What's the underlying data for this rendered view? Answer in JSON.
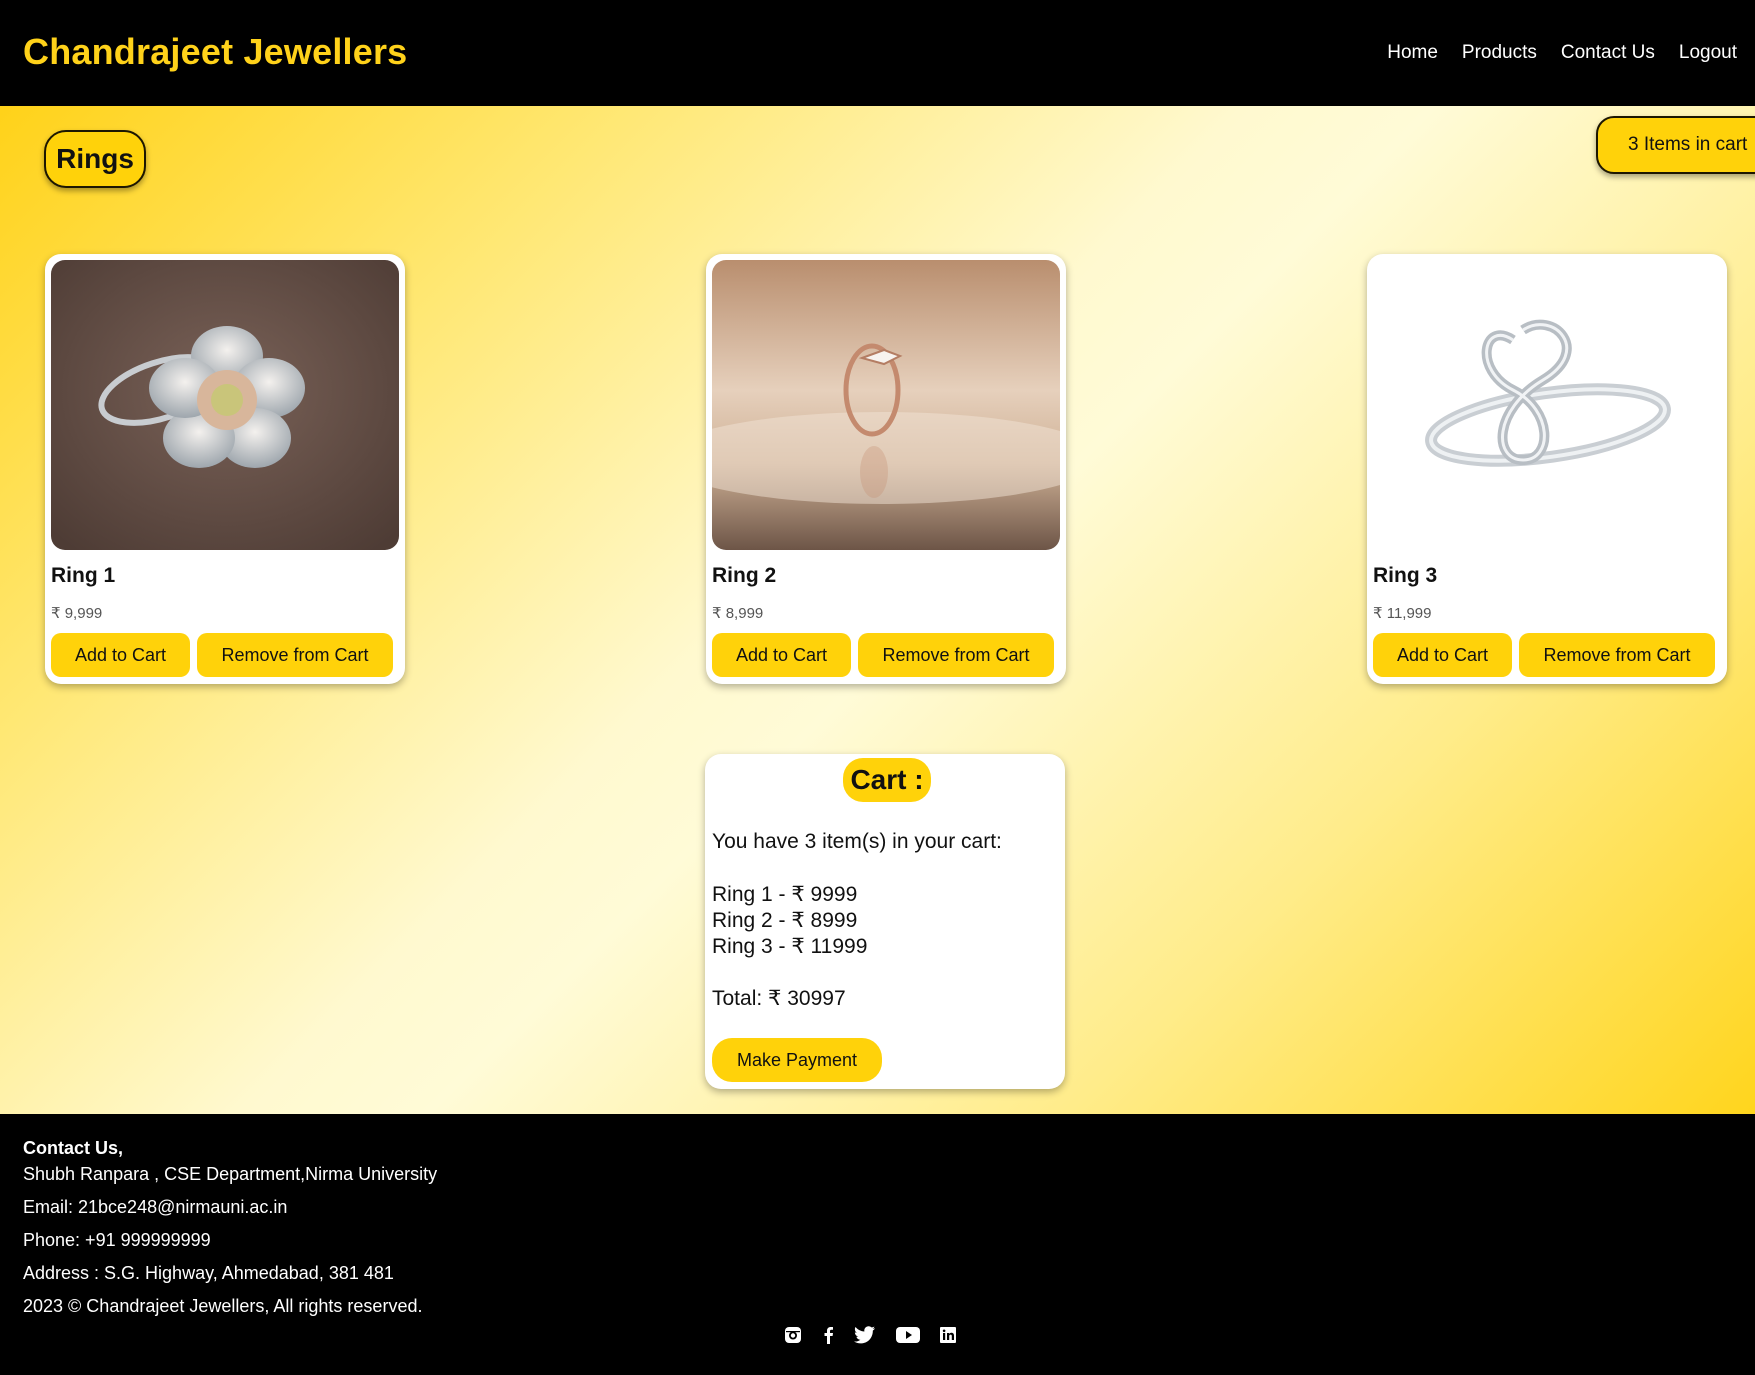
{
  "header": {
    "brand": "Chandrajeet Jewellers",
    "nav": [
      "Home",
      "Products",
      "Contact Us",
      "Logout"
    ]
  },
  "main": {
    "section_title": "Rings",
    "cart_count_label": "3 Items in cart",
    "products": [
      {
        "name": "Ring 1",
        "price": "₹ 9,999",
        "add_label": "Add to Cart",
        "remove_label": "Remove from Cart"
      },
      {
        "name": "Ring 2",
        "price": "₹ 8,999",
        "add_label": "Add to Cart",
        "remove_label": "Remove from Cart"
      },
      {
        "name": "Ring 3",
        "price": "₹ 11,999",
        "add_label": "Add to Cart",
        "remove_label": "Remove from Cart"
      }
    ],
    "cart": {
      "title": "Cart :",
      "summary": "You have 3 item(s) in your cart:",
      "items": [
        "Ring 1 - ₹ 9999",
        "Ring 2 - ₹ 8999",
        "Ring 3 - ₹ 11999"
      ],
      "total": "Total: ₹ 30997",
      "pay_label": "Make Payment"
    }
  },
  "footer": {
    "heading": "Contact Us,",
    "lines": [
      "Shubh Ranpara , CSE Department,Nirma University",
      "Email: 21bce248@nirmauni.ac.in",
      "Phone: +91 999999999",
      "Address : S.G. Highway, Ahmedabad, 381 481",
      "2023 © Chandrajeet Jewellers, All rights reserved."
    ],
    "social_icons": [
      "instagram-icon",
      "facebook-icon",
      "twitter-icon",
      "youtube-icon",
      "linkedin-icon"
    ]
  },
  "colors": {
    "accent": "#ffd20a",
    "header_bg": "#000000",
    "brand_text": "#ffd21a"
  }
}
